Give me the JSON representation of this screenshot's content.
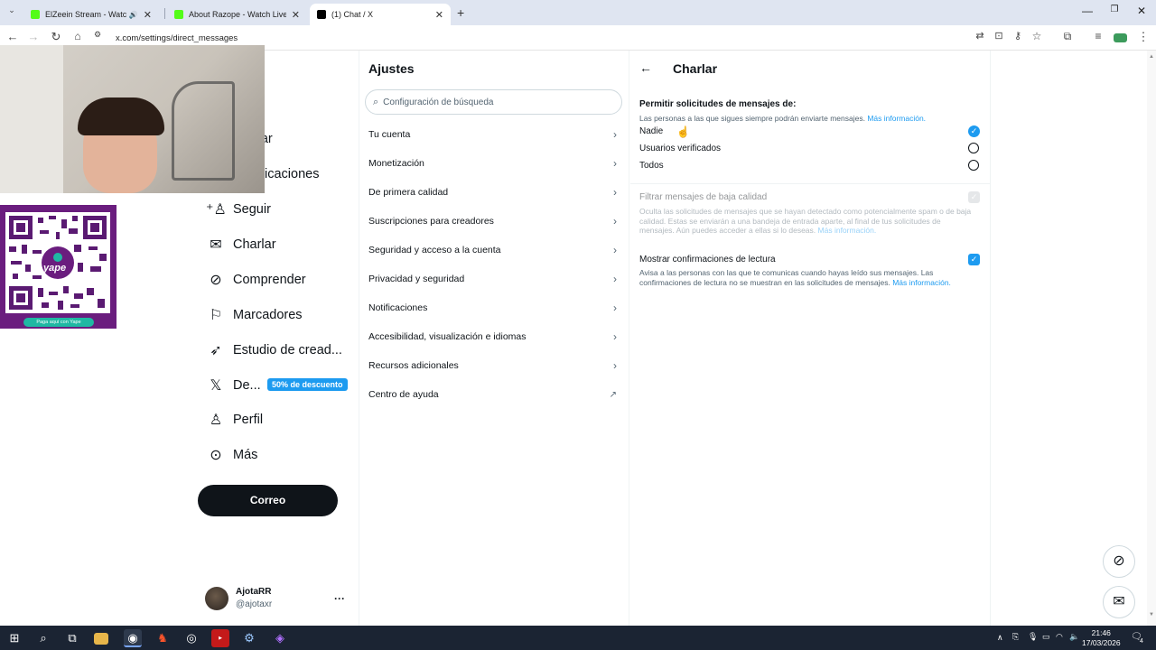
{
  "browser": {
    "tabs": [
      {
        "title": "ElZeein Stream - Watch Live",
        "favicon_color": "#53fc18"
      },
      {
        "title": "About Razope - Watch Live on",
        "favicon_color": "#53fc18"
      },
      {
        "title": "(1) Chat / X",
        "favicon_color": "#000000"
      }
    ],
    "new_tab": "+",
    "url": "x.com/settings/direct_messages"
  },
  "nav": {
    "items": [
      {
        "label": "rar",
        "icon": "explore-icon"
      },
      {
        "label": "icaciones",
        "icon": "bell-icon"
      },
      {
        "label": "Seguir",
        "icon": "follow-icon"
      },
      {
        "label": "Charlar",
        "icon": "mail-icon"
      },
      {
        "label": "Comprender",
        "icon": "grok-icon"
      },
      {
        "label": "Marcadores",
        "icon": "bookmark-icon"
      },
      {
        "label": "Estudio de cread...",
        "icon": "rocket-icon"
      },
      {
        "label": "De...",
        "icon": "x-logo-icon"
      },
      {
        "label": "Perfil",
        "icon": "person-icon"
      },
      {
        "label": "Más",
        "icon": "more-circle-icon"
      }
    ],
    "promo_badge": "50% de descuento",
    "post_button": "Correo"
  },
  "overlay": {
    "qr_brand": "yape",
    "qr_caption": "Paga aquí con Yape"
  },
  "settings": {
    "title": "Ajustes",
    "search_placeholder": "Configuración de búsqueda",
    "items": [
      "Tu cuenta",
      "Monetización",
      "De primera calidad",
      "Suscripciones para creadores",
      "Seguridad y acceso a la cuenta",
      "Privacidad y seguridad",
      "Notificaciones",
      "Accesibilidad, visualización e idiomas",
      "Recursos adicionales",
      "Centro de ayuda"
    ]
  },
  "chat": {
    "title": "Charlar",
    "allow_heading": "Permitir solicitudes de mensajes de:",
    "allow_desc": "Las personas a las que sigues siempre podrán enviarte mensajes.",
    "more_info": "Más información.",
    "options": [
      "Nadie",
      "Usuarios verificados",
      "Todos"
    ],
    "selected_option": "Nadie",
    "filter_title": "Filtrar mensajes de baja calidad",
    "filter_desc": "Oculta las solicitudes de mensajes que se hayan detectado como potencialmente spam o de baja calidad. Estas se enviarán a una bandeja de entrada aparte, al final de tus solicitudes de mensajes. Aún puedes acceder a ellas si lo deseas.",
    "read_title": "Mostrar confirmaciones de lectura",
    "read_desc": "Avisa a las personas con las que te comunicas cuando hayas leído sus mensajes. Las confirmaciones de lectura no se muestran en las solicitudes de mensajes."
  },
  "account": {
    "name": "AjotaRR",
    "handle": "@ajotaxr",
    "more": "···"
  },
  "taskbar": {
    "time": "21:46",
    "date": "17/03/2026",
    "notif_count": "4"
  },
  "colors": {
    "accent": "#1d9bf0",
    "text": "#0f1419",
    "muted": "#536471"
  }
}
